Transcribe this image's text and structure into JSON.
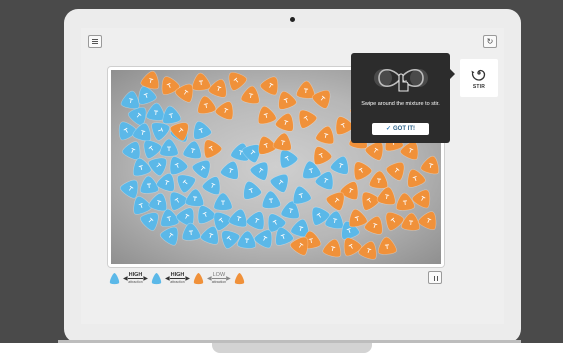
{
  "toolbar": {
    "menu_icon": "hamburger-menu-icon",
    "reset_icon": "refresh-icon",
    "reset_glyph": "↻"
  },
  "stir": {
    "label": "STIR",
    "icon": "stir-spiral-icon"
  },
  "hint": {
    "message": "Swipe around the mixture to stir.",
    "button_label": "GOT IT!",
    "button_icon": "checkmark-icon"
  },
  "legend": {
    "items": [
      {
        "arrow_word": "HIGH",
        "arrow_sub": "attraction"
      },
      {
        "arrow_word": "HIGH",
        "arrow_sub": "attraction"
      },
      {
        "arrow_word": "LOW",
        "arrow_sub": "attraction"
      }
    ]
  },
  "playback": {
    "pause_icon": "pause-icon"
  },
  "colors": {
    "blue_molecule": "#5bb8e8",
    "orange_molecule": "#f0913a",
    "background": "#4a4a4a",
    "popup": "#2c2c2c"
  }
}
